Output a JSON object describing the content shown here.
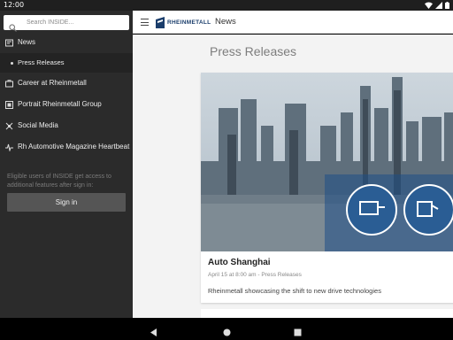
{
  "status_bar": {
    "time": "12:00"
  },
  "drawer": {
    "search_placeholder": "Search INSIDE...",
    "items": [
      {
        "label": "News",
        "icon": "news-icon",
        "active": true
      },
      {
        "label": "Press Releases",
        "sub": true
      },
      {
        "label": "Career at Rheinmetall",
        "icon": "career-icon"
      },
      {
        "label": "Portrait Rheinmetall Group",
        "icon": "portrait-icon"
      },
      {
        "label": "Social Media",
        "icon": "social-media-icon"
      },
      {
        "label": "Rh Automotive Magazine Heartbeat",
        "icon": "heartbeat-icon"
      }
    ],
    "hint": "Eligible users of INSIDE get access to additional features after sign in:",
    "sign_in_label": "Sign in"
  },
  "app_bar": {
    "logo_text": "RHEINMETALL",
    "title": "News"
  },
  "main": {
    "section_title": "Press Releases",
    "card": {
      "headline": "Auto Shanghai",
      "meta": "April 15 at 8:00 am - Press Releases",
      "teaser": "Rheinmetall showcasing the shift to new drive technologies"
    }
  },
  "colors": {
    "drawer_bg": "#2b2b2b",
    "brand_blue": "#1a3d6b",
    "content_bg": "#f3f3f3"
  }
}
